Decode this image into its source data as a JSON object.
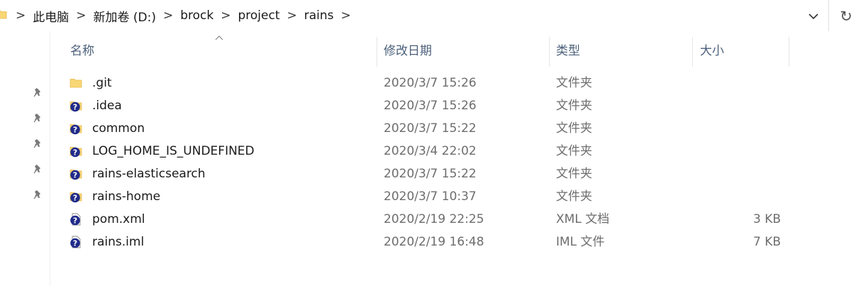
{
  "breadcrumb": [
    "此电脑",
    "新加卷 (D:)",
    "brock",
    "project",
    "rains"
  ],
  "breadcrumb_separator": ">",
  "refresh_glyph": "↻",
  "columns": {
    "name": "名称",
    "modified": "修改日期",
    "type": "类型",
    "size": "大小"
  },
  "sort_column": "name",
  "files": [
    {
      "name": ".git",
      "modified": "2020/3/7 15:26",
      "type": "文件夹",
      "size": "",
      "icon": "folder-icon"
    },
    {
      "name": ".idea",
      "modified": "2020/3/7 15:26",
      "type": "文件夹",
      "size": "",
      "icon": "folder-question-icon"
    },
    {
      "name": "common",
      "modified": "2020/3/7 15:22",
      "type": "文件夹",
      "size": "",
      "icon": "folder-question-icon"
    },
    {
      "name": "LOG_HOME_IS_UNDEFINED",
      "modified": "2020/3/4 22:02",
      "type": "文件夹",
      "size": "",
      "icon": "folder-question-icon"
    },
    {
      "name": "rains-elasticsearch",
      "modified": "2020/3/7 15:22",
      "type": "文件夹",
      "size": "",
      "icon": "folder-question-icon"
    },
    {
      "name": "rains-home",
      "modified": "2020/3/7 10:37",
      "type": "文件夹",
      "size": "",
      "icon": "folder-question-icon"
    },
    {
      "name": "pom.xml",
      "modified": "2020/2/19 22:25",
      "type": "XML 文档",
      "size": "3 KB",
      "icon": "file-question-icon"
    },
    {
      "name": "rains.iml",
      "modified": "2020/2/19 16:48",
      "type": "IML 文件",
      "size": "7 KB",
      "icon": "file-question-icon"
    }
  ],
  "pinned_count": 5,
  "colors": {
    "folder": "#f8d775",
    "folder_dark": "#e7b84a",
    "question_badge": "#1f2a8a",
    "header_text": "#4c607a"
  }
}
